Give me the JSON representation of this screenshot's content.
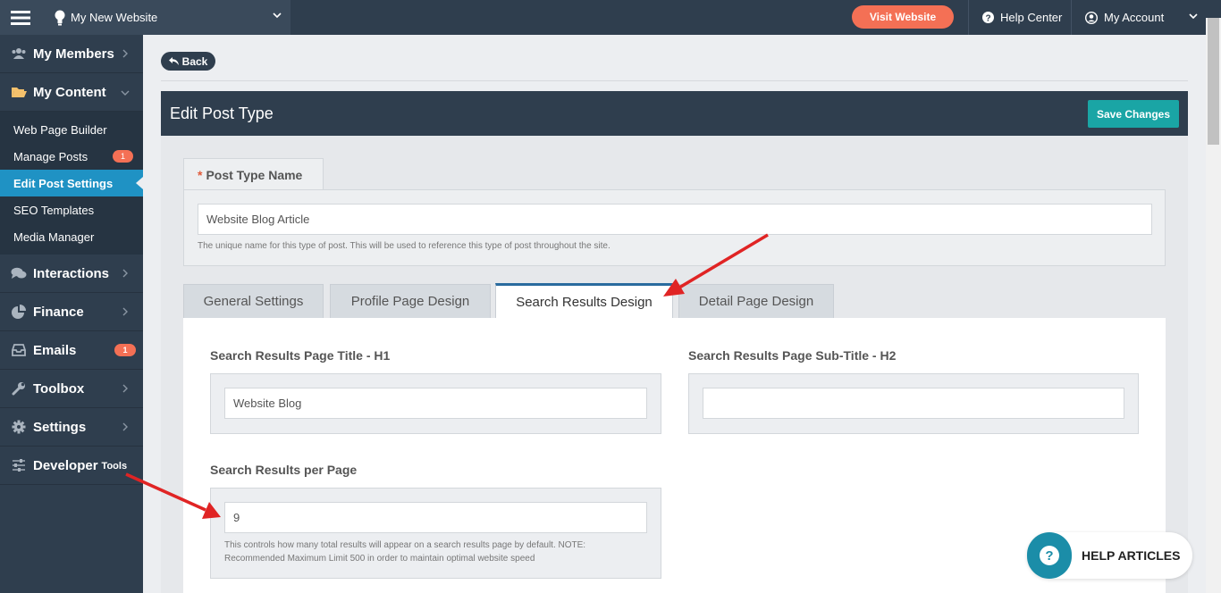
{
  "topbar": {
    "site_name": "My New Website",
    "visit_label": "Visit Website",
    "help_label": "Help Center",
    "account_label": "My Account"
  },
  "sidebar": {
    "members": "My Members",
    "content": "My Content",
    "sub_items": [
      {
        "label": "Web Page Builder"
      },
      {
        "label": "Manage Posts",
        "badge": "1"
      },
      {
        "label": "Edit Post Settings"
      },
      {
        "label": "SEO Templates"
      },
      {
        "label": "Media Manager"
      }
    ],
    "interactions": "Interactions",
    "finance": "Finance",
    "emails": "Emails",
    "emails_badge": "1",
    "toolbox": "Toolbox",
    "settings": "Settings",
    "developer": "Developer",
    "developer_small": "Tools"
  },
  "back_label": "Back",
  "panel": {
    "title": "Edit Post Type",
    "save_label": "Save Changes",
    "name_tab": "Post Type Name",
    "required_mark": "*",
    "name_value": "Website Blog Article",
    "name_hint": "The unique name for this type of post. This will be used to reference this type of post throughout the site.",
    "tabs": [
      "General Settings",
      "Profile Page Design",
      "Search Results Design",
      "Detail Page Design"
    ],
    "active_tab": "Search Results Design",
    "h1_label": "Search Results Page Title - H1",
    "h1_value": "Website Blog",
    "h2_label": "Search Results Page Sub-Title - H2",
    "h2_value": "",
    "per_page_label": "Search Results per Page",
    "per_page_value": "9",
    "per_page_hint": "This controls how many total results will appear on a search results page by default. NOTE: Recommended Maximum Limit 500 in order to maintain optimal website speed"
  },
  "help_articles": "HELP ARTICLES",
  "colors": {
    "accent_orange": "#f47055",
    "nav_dark": "#2f3e4e",
    "active_blue": "#1f92c4",
    "save_teal": "#1aa5a5",
    "arrow_red": "#e02424"
  }
}
